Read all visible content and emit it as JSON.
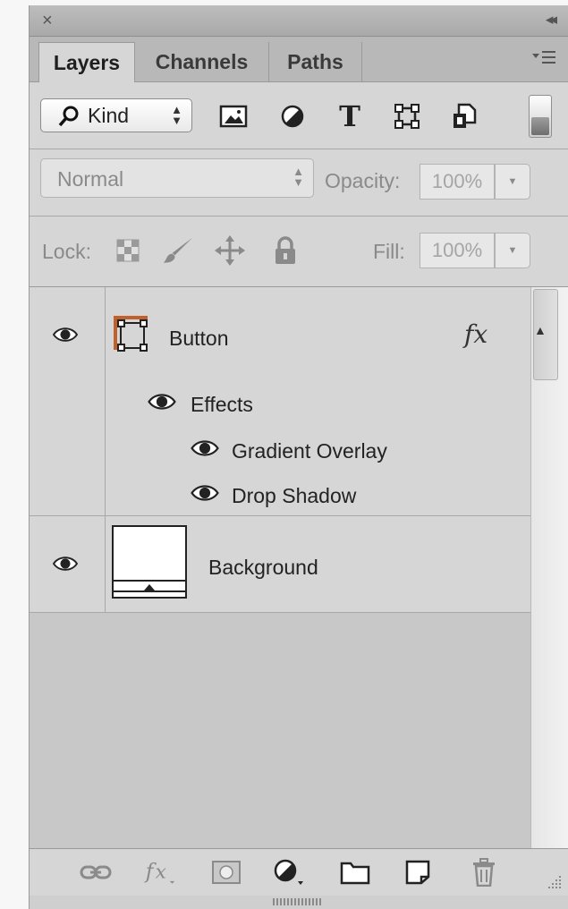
{
  "window": {
    "close_glyph": "×",
    "collapse_glyph": "◂◂"
  },
  "tabs": [
    {
      "label": "Layers",
      "active": true
    },
    {
      "label": "Channels",
      "active": false
    },
    {
      "label": "Paths",
      "active": false
    }
  ],
  "filter": {
    "kind_label": "Kind",
    "icons": [
      "image-filter-icon",
      "adjustment-filter-icon",
      "type-filter-icon",
      "shape-filter-icon",
      "smart-object-filter-icon"
    ],
    "type_glyph": "T"
  },
  "blend": {
    "mode": "Normal",
    "opacity_label": "Opacity:",
    "opacity_value": "100%"
  },
  "lock": {
    "label": "Lock:",
    "fill_label": "Fill:",
    "fill_value": "100%"
  },
  "layers": [
    {
      "name": "Button",
      "visible": true,
      "fx_label": "fx",
      "effects_label": "Effects",
      "effects": [
        "Gradient Overlay",
        "Drop Shadow"
      ]
    },
    {
      "name": "Background",
      "visible": true
    }
  ],
  "bottom_icons": [
    "link-layers-icon",
    "fx-icon",
    "add-mask-icon",
    "new-adjustment-icon",
    "new-group-icon",
    "new-layer-icon",
    "delete-icon"
  ],
  "colors": {
    "panel_bg": "#d6d6d6",
    "shape_accent": "#c0602a"
  }
}
